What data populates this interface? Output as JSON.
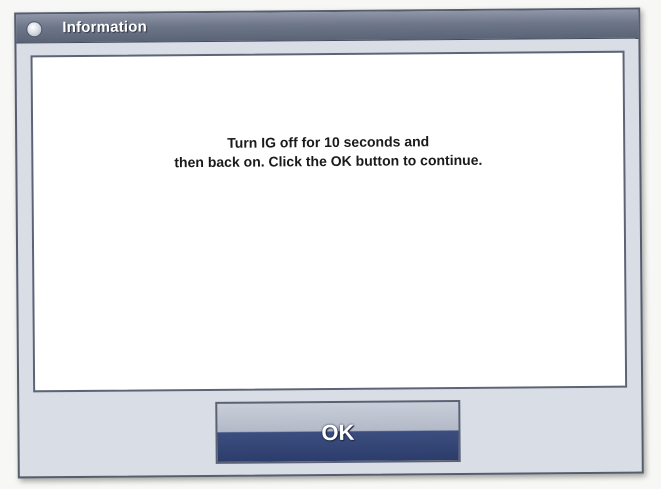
{
  "dialog": {
    "title": "Information",
    "icon": "info-orb-icon",
    "message": "Turn IG off for 10 seconds and\nthen back on. Click the OK button to continue.",
    "ok_label": "OK"
  },
  "colors": {
    "titlebar": "#6e7689",
    "dialog_background": "#d8dde6",
    "button_lower": "#2c3d6c",
    "button_upper": "#c9ced9"
  }
}
